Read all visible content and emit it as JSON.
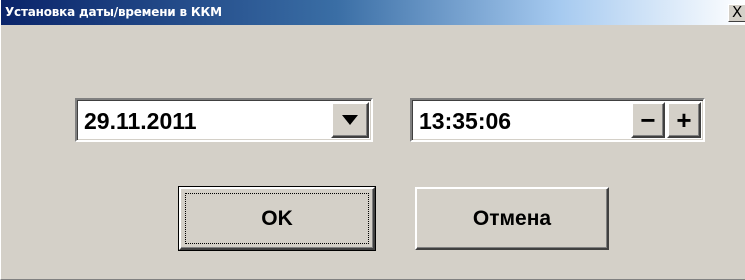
{
  "window": {
    "title": "Установка даты/времени в ККМ",
    "close_label": "X"
  },
  "date_field": {
    "value": "29.11.2011",
    "dropdown_icon": "triangle-down-icon"
  },
  "time_field": {
    "value": "13:35:06",
    "decrement_label": "−",
    "increment_label": "+"
  },
  "buttons": {
    "ok_label": "OK",
    "cancel_label": "Отмена"
  },
  "colors": {
    "face": "#d4d0c8",
    "title_start": "#0a246a",
    "title_end": "#a6caf0"
  }
}
